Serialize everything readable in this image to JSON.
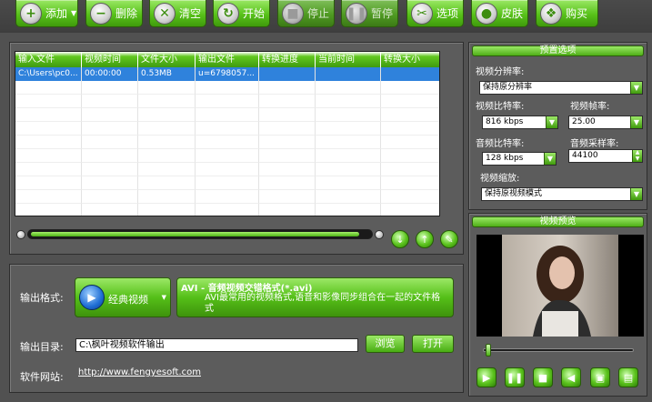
{
  "toolbar": {
    "add": "添加",
    "delete": "删除",
    "clear": "清空",
    "start": "开始",
    "stop": "停止",
    "pause": "暂停",
    "options": "选项",
    "skin": "皮肤",
    "buy": "购买"
  },
  "file_table": {
    "columns": [
      "输入文件",
      "视频时间",
      "文件大小",
      "输出文件",
      "转换进度",
      "当前时间",
      "转换大小"
    ],
    "rows": [
      [
        "C:\\Users\\pc0...",
        "00:00:00",
        "0.53MB",
        "u=6798057...",
        "",
        "",
        ""
      ]
    ]
  },
  "progress": {
    "value": 0.97
  },
  "preset": {
    "title": "预置选项",
    "resolution_label": "视频分辨率:",
    "resolution_value": "保持原分辨率",
    "video_bitrate_label": "视频比特率:",
    "video_bitrate_value": "816 kbps",
    "frame_rate_label": "视频帧率:",
    "frame_rate_value": "25.00",
    "audio_bitrate_label": "音频比特率:",
    "audio_bitrate_value": "128 kbps",
    "sample_rate_label": "音频采样率:",
    "sample_rate_value": "44100",
    "scale_label": "视频缩放:",
    "scale_value": "保持原视频模式"
  },
  "preview": {
    "title": "视频预览",
    "seek": 0.02
  },
  "output": {
    "format_label": "输出格式:",
    "category": "经典视频",
    "format_name": "AVI - 音频视频交错格式(*.avi)",
    "format_desc": "AVI最常用的视频格式,语音和影像同步组合在一起的文件格式",
    "dir_label": "输出目录:",
    "dir_value": "C:\\枫叶视频软件输出",
    "browse": "浏览",
    "open": "打开",
    "site_label": "软件网站:",
    "site_url": "http://www.fengyesoft.com"
  },
  "colors": {
    "accent": "#58c21a",
    "background": "#515151",
    "selection": "#2f82dc"
  }
}
